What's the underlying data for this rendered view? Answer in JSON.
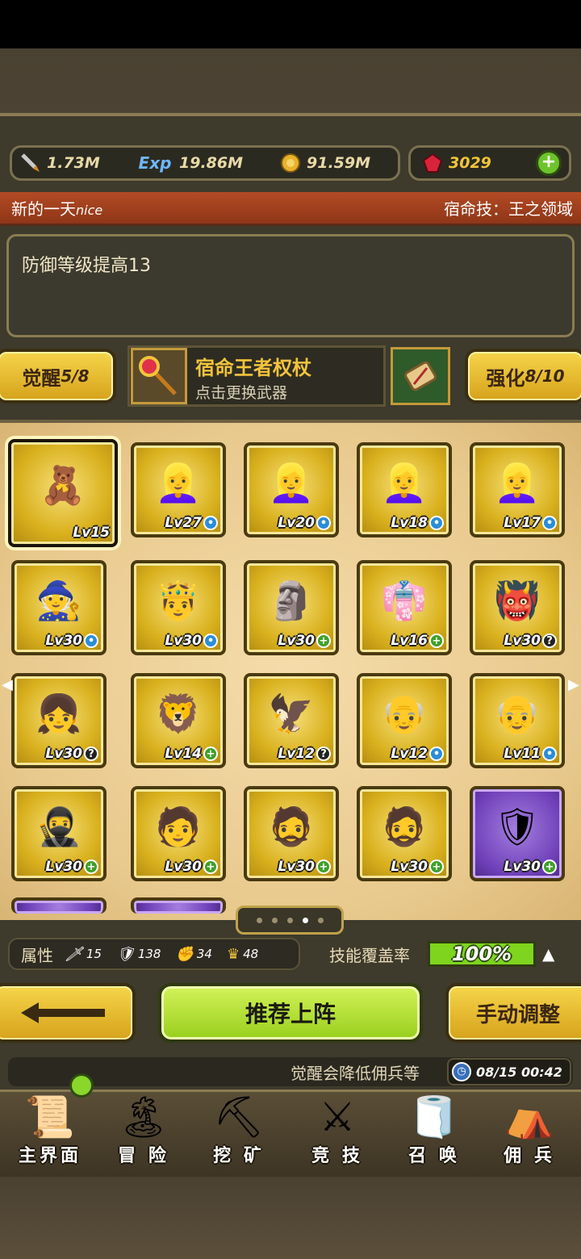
{
  "resources": {
    "attack": "1.73M",
    "exp": "19.86M",
    "gold": "91.59M",
    "gems": "3029",
    "exp_tag": "Exp"
  },
  "banner": {
    "left": "新的一天",
    "left_suffix": "nice",
    "right": "宿命技：王之领域"
  },
  "description": "防御等级提高13",
  "awaken": {
    "label": "觉醒",
    "value": "5/8"
  },
  "weapon": {
    "name": "宿命王者权杖",
    "hint": "点击更换武器"
  },
  "strengthen": {
    "label": "强化",
    "value": "8/10"
  },
  "heroes": [
    {
      "lv": "Lv15",
      "badge": "",
      "icon": "bear",
      "frame": "gold",
      "selected": true
    },
    {
      "lv": "Lv27",
      "badge": "blue",
      "icon": "blonde-maid",
      "frame": "gold"
    },
    {
      "lv": "Lv20",
      "badge": "blue",
      "icon": "blonde-maid",
      "frame": "gold"
    },
    {
      "lv": "Lv18",
      "badge": "blue",
      "icon": "blonde-maid",
      "frame": "gold"
    },
    {
      "lv": "Lv17",
      "badge": "blue",
      "icon": "blonde-maid",
      "frame": "gold"
    },
    {
      "lv": "Lv30",
      "badge": "blue",
      "icon": "elder-mage",
      "frame": "gold"
    },
    {
      "lv": "Lv30",
      "badge": "blue",
      "icon": "golden-knight",
      "frame": "gold"
    },
    {
      "lv": "Lv30",
      "badge": "green",
      "icon": "stone-gargoyle",
      "frame": "gold"
    },
    {
      "lv": "Lv16",
      "badge": "green",
      "icon": "shrine-maiden",
      "frame": "gold"
    },
    {
      "lv": "Lv30",
      "badge": "q",
      "icon": "red-hair-brawler",
      "frame": "gold"
    },
    {
      "lv": "Lv30",
      "badge": "q",
      "icon": "dark-hair-girl",
      "frame": "gold"
    },
    {
      "lv": "Lv14",
      "badge": "green",
      "icon": "golden-beast",
      "frame": "gold"
    },
    {
      "lv": "Lv12",
      "badge": "q",
      "icon": "totem-bird",
      "frame": "gold"
    },
    {
      "lv": "Lv12",
      "badge": "blue",
      "icon": "bald-monk",
      "frame": "gold"
    },
    {
      "lv": "Lv11",
      "badge": "blue",
      "icon": "bald-monk",
      "frame": "gold"
    },
    {
      "lv": "Lv30",
      "badge": "green",
      "icon": "blue-ninja",
      "frame": "gold"
    },
    {
      "lv": "Lv30",
      "badge": "green",
      "icon": "black-hair-fighter",
      "frame": "gold"
    },
    {
      "lv": "Lv30",
      "badge": "green",
      "icon": "bearded-king",
      "frame": "gold"
    },
    {
      "lv": "Lv30",
      "badge": "green",
      "icon": "bearded-king",
      "frame": "gold"
    },
    {
      "lv": "Lv30",
      "badge": "green",
      "icon": "grey-warrior",
      "frame": "purple"
    }
  ],
  "attributes": {
    "label": "属性",
    "items": [
      "15",
      "138",
      "34",
      "48"
    ]
  },
  "coverage": {
    "label": "技能覆盖率",
    "value": "100%"
  },
  "actions": {
    "recommend": "推荐上阵",
    "manual": "手动调整"
  },
  "notice": "觉醒会降低佣兵等",
  "time": "08/15 00:42",
  "nav": [
    "主界面",
    "冒 险",
    "挖 矿",
    "竞 技",
    "召 唤",
    "佣 兵"
  ],
  "colors": {
    "accent_green": "#98cf1c",
    "gold": "#d6a21c",
    "banner_red": "#b34a24"
  }
}
